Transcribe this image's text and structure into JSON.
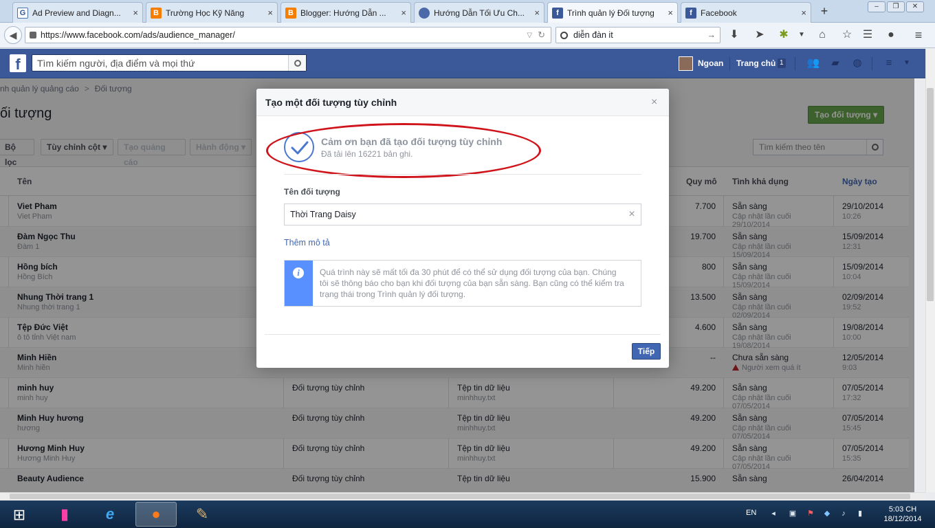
{
  "browser": {
    "tabs": [
      {
        "title": "Ad Preview and Diagn...",
        "icon": "google-g-icon",
        "active": false
      },
      {
        "title": "Trường Học Kỹ Năng",
        "icon": "blogger-icon",
        "active": false
      },
      {
        "title": "Blogger: Hướng Dẫn ...",
        "icon": "blogger-icon",
        "active": false
      },
      {
        "title": "Hướng Dẫn Tối Ưu Ch...",
        "icon": "site-icon",
        "active": false
      },
      {
        "title": "Trình quản lý Đối tượng",
        "icon": "facebook-icon",
        "active": true
      },
      {
        "title": "Facebook",
        "icon": "facebook-icon",
        "active": false
      }
    ],
    "tab_close": "×",
    "new_tab": "+",
    "url": "https://www.facebook.com/ads/audience_manager/",
    "search_query": "diễn đàn it"
  },
  "fb": {
    "logo": "f",
    "search_placeholder": "Tìm kiếm người, địa điểm và mọi thứ",
    "user_name": "Ngoan",
    "home_label": "Trang chủ",
    "home_count": "1"
  },
  "page": {
    "breadcrumb_root": "nh quản lý quảng cáo",
    "breadcrumb_sep": ">",
    "breadcrumb_current": "Đối tượng",
    "title": "ối tượng",
    "create_button": "Tạo đối tượng ▾",
    "toolbar": {
      "filter": "Bộ lọc",
      "columns": "Tùy chỉnh cột ▾",
      "create_ad": "Tạo quảng cáo",
      "actions": "Hành động ▾"
    },
    "name_search_placeholder": "Tìm kiếm theo tên",
    "columns": {
      "name": "Tên",
      "size": "Quy mô",
      "availability": "Tình khả dụng",
      "created": "Ngày tạo"
    },
    "rows": [
      {
        "name": "Viet Pham",
        "desc": "Viet Pham",
        "type": "",
        "source": "",
        "source_file": "",
        "size": "7.700",
        "status": "Sẵn sàng",
        "status_sub": "Cập nhật lần cuối",
        "status_date": "29/10/2014",
        "date": "29/10/2014",
        "time": "10:26",
        "warn": false
      },
      {
        "name": "Đàm Ngọc Thu",
        "desc": "Đàm 1",
        "type": "",
        "source": "",
        "source_file": "",
        "size": "19.700",
        "status": "Sẵn sàng",
        "status_sub": "Cập nhật lần cuối",
        "status_date": "15/09/2014",
        "date": "15/09/2014",
        "time": "12:31",
        "warn": false
      },
      {
        "name": "Hồng bích",
        "desc": "Hồng Bích",
        "type": "",
        "source": "",
        "source_file": "",
        "size": "800",
        "status": "Sẵn sàng",
        "status_sub": "Cập nhật lần cuối",
        "status_date": "15/09/2014",
        "date": "15/09/2014",
        "time": "10:04",
        "warn": false
      },
      {
        "name": "Nhung Thời trang 1",
        "desc": "Nhung thời trang 1",
        "type": "",
        "source": "",
        "source_file": "",
        "size": "13.500",
        "status": "Sẵn sàng",
        "status_sub": "Cập nhật lần cuối",
        "status_date": "02/09/2014",
        "date": "02/09/2014",
        "time": "19:52",
        "warn": false
      },
      {
        "name": "Tệp Đức Việt",
        "desc": "ô tô tỉnh Việt nam",
        "type": "",
        "source": "",
        "source_file": "",
        "size": "4.600",
        "status": "Sẵn sàng",
        "status_sub": "Cập nhật lần cuối",
        "status_date": "19/08/2014",
        "date": "19/08/2014",
        "time": "10:00",
        "warn": false
      },
      {
        "name": "Minh Hiền",
        "desc": "Minh hiền",
        "type": "",
        "source": "",
        "source_file": "",
        "size": "--",
        "status": "Chưa sẵn sàng",
        "status_sub": "Người xem quá ít",
        "status_date": "",
        "date": "12/05/2014",
        "time": "9:03",
        "warn": true
      },
      {
        "name": "minh huy",
        "desc": "minh huy",
        "type": "Đối tượng tùy chỉnh",
        "source": "Tệp tin dữ liệu",
        "source_file": "minhhuy.txt",
        "size": "49.200",
        "status": "Sẵn sàng",
        "status_sub": "Cập nhật lần cuối",
        "status_date": "07/05/2014",
        "date": "07/05/2014",
        "time": "17:32",
        "warn": false
      },
      {
        "name": "Minh Huy hương",
        "desc": "hương",
        "type": "Đối tượng tùy chỉnh",
        "source": "Tệp tin dữ liệu",
        "source_file": "minhhuy.txt",
        "size": "49.200",
        "status": "Sẵn sàng",
        "status_sub": "Cập nhật lần cuối",
        "status_date": "07/05/2014",
        "date": "07/05/2014",
        "time": "15:45",
        "warn": false
      },
      {
        "name": "Hương Minh Huy",
        "desc": "Hương Minh Huy",
        "type": "Đối tượng tùy chỉnh",
        "source": "Tệp tin dữ liệu",
        "source_file": "minhhuy.txt",
        "size": "49.200",
        "status": "Sẵn sàng",
        "status_sub": "Cập nhật lần cuối",
        "status_date": "07/05/2014",
        "date": "07/05/2014",
        "time": "15:35",
        "warn": false
      },
      {
        "name": "Beauty Audience",
        "desc": "",
        "type": "Đối tượng tùy chỉnh",
        "source": "Tệp tin dữ liệu",
        "source_file": "",
        "size": "15.900",
        "status": "Sẵn sàng",
        "status_sub": "",
        "status_date": "",
        "date": "26/04/2014",
        "time": "",
        "warn": false
      }
    ]
  },
  "dialog": {
    "title": "Tạo một đối tượng tùy chỉnh",
    "close": "×",
    "success_title": "Cảm ơn bạn đã tạo đối tượng tùy chỉnh",
    "success_sub": "Đã tải lên 16221 bản ghi.",
    "name_label": "Tên đối tượng",
    "name_value": "Thời Trang Daisy",
    "clear": "×",
    "add_description": "Thêm mô tả",
    "info_icon": "i",
    "info_text": "Quá trình này sẽ mất tối đa 30 phút để có thể sử dụng đối tượng của bạn. Chúng tôi sẽ thông báo cho bạn khi đối tượng của bạn sẵn sàng. Bạn cũng có thể kiểm tra trạng thái trong Trình quản lý đối tượng.",
    "next_button": "Tiếp"
  },
  "taskbar": {
    "language": "EN",
    "time": "5:03 CH",
    "date": "18/12/2014"
  },
  "colors": {
    "fb_blue": "#3b5998",
    "create_green": "#69a74e",
    "annotation_red": "#d0141b",
    "info_blue": "#5890ff"
  }
}
